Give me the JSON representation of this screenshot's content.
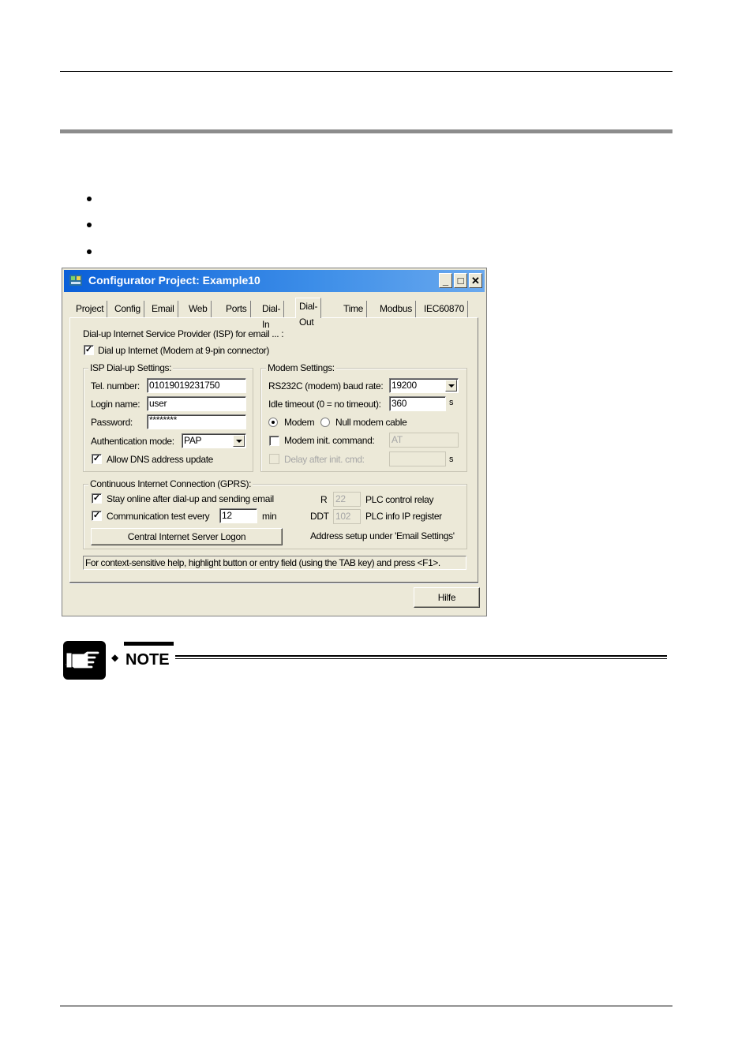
{
  "window": {
    "title": "Configurator Project: Example10",
    "controls": {
      "minimize": "_",
      "maximize": "□",
      "close": "✕"
    }
  },
  "tabs": [
    "Project",
    "Config",
    "Email",
    "Web",
    "Ports",
    "Dial-In",
    "Dial-Out",
    "Time",
    "Modbus",
    "IEC60870"
  ],
  "active_tab": "Dial-Out",
  "dialout": {
    "isp_heading": "Dial-up Internet Service Provider (ISP) for email ... :",
    "dial_up_internet": {
      "label": "Dial up Internet (Modem at 9-pin connector)",
      "checked": true
    },
    "isp_group": {
      "title": "ISP Dial-up Settings:",
      "tel_label": "Tel. number:",
      "tel_value": "01019019231750",
      "login_label": "Login name:",
      "login_value": "user",
      "password_label": "Password:",
      "password_value": "********",
      "auth_label": "Authentication mode:",
      "auth_value": "PAP",
      "dns": {
        "label": "Allow DNS address update",
        "checked": true
      }
    },
    "modem_group": {
      "title": "Modem Settings:",
      "baud_label": "RS232C (modem) baud rate:",
      "baud_value": "19200",
      "idle_label": "Idle timeout (0 = no timeout):",
      "idle_value": "360",
      "idle_unit": "s",
      "radio_modem": "Modem",
      "radio_null": "Null modem cable",
      "selected_radio": "Modem",
      "init_label": "Modem init. command:",
      "init_value": "AT",
      "init_checked": false,
      "delay_label": "Delay after init. cmd:",
      "delay_value": "",
      "delay_unit": "s"
    },
    "gprs_group": {
      "title": "Continuous Internet Connection (GPRS):",
      "stay_online": {
        "label": "Stay online after dial-up and sending email",
        "checked": true
      },
      "comm_test": {
        "label": "Communication test every",
        "checked": true,
        "value": "12",
        "unit": "min"
      },
      "r_label": "R",
      "r_value": "22",
      "r_desc": "PLC control relay",
      "ddt_label": "DDT",
      "ddt_value": "102",
      "ddt_desc": "PLC info IP register",
      "logon_button": "Central Internet Server Logon",
      "address_note": "Address setup under 'Email Settings'"
    },
    "help_text": "For context-sensitive help, highlight button or entry field (using the TAB key) and press <F1>."
  },
  "footer_button": "Hilfe",
  "note": {
    "label": "NOTE"
  }
}
